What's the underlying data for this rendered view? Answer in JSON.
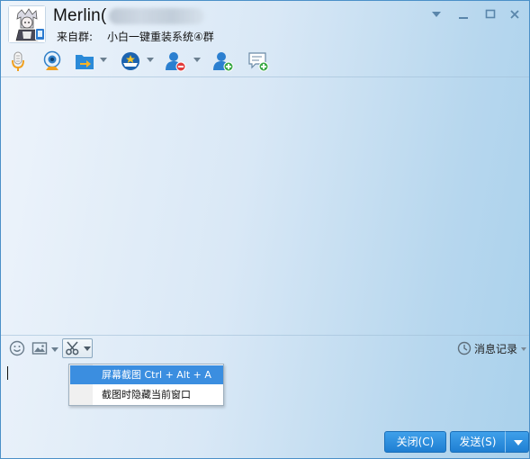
{
  "window": {
    "contact_name": "Merlin(",
    "from_label": "来自群:",
    "group_name": "小白一键重装系统④群"
  },
  "toolbar": {
    "icons": [
      "microphone-icon",
      "video-call-icon",
      "file-transfer-icon",
      "remote-assist-icon",
      "block-contact-icon",
      "add-friend-icon",
      "create-discussion-icon"
    ]
  },
  "input_toolbar": {
    "history_label": "消息记录"
  },
  "screenshot_menu": {
    "items": [
      {
        "label": "屏幕截图 Ctrl + Alt + A",
        "highlighted": true
      },
      {
        "label": "截图时隐藏当前窗口",
        "highlighted": false
      }
    ]
  },
  "buttons": {
    "close_label": "关闭(C)",
    "send_label": "发送(S)"
  },
  "colors": {
    "accent": "#2a88dc",
    "menu_highlight": "#3b8ee0"
  }
}
